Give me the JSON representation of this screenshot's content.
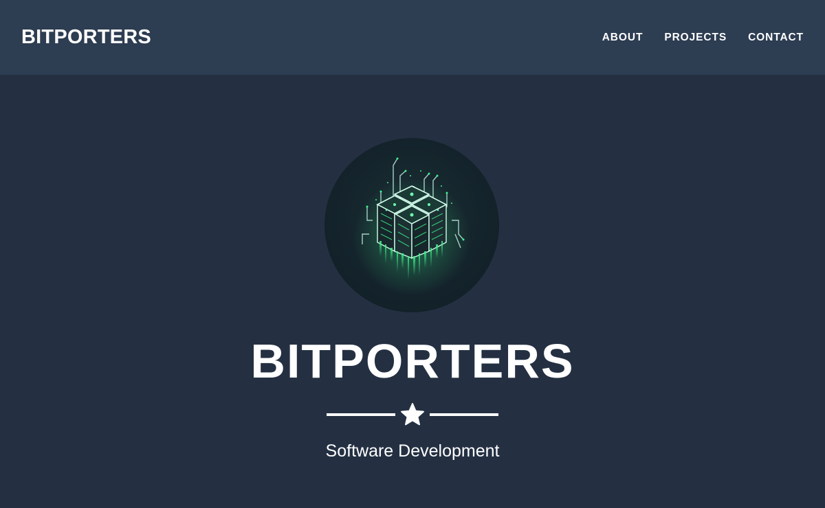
{
  "nav": {
    "brand": "BITPORTERS",
    "links": [
      {
        "label": "ABOUT"
      },
      {
        "label": "PROJECTS"
      },
      {
        "label": "CONTACT"
      }
    ]
  },
  "hero": {
    "title": "BITPORTERS",
    "subtitle": "Software Development",
    "divider_icon": "star-icon",
    "logo": "server-cube-logo"
  },
  "colors": {
    "page_bg": "#243042",
    "nav_bg": "#2d3d52",
    "accent_green": "#3cf28a",
    "text": "#ffffff"
  }
}
